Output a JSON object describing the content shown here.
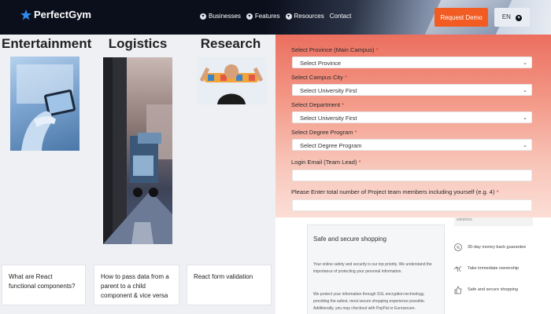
{
  "nav": {
    "brand": "PerfectGym",
    "links": [
      "Businesses",
      "Features",
      "Resources",
      "Contact"
    ],
    "demo_button": "Request Demo",
    "language": "EN"
  },
  "categories": [
    "Entertainment",
    "Logistics",
    "Research"
  ],
  "articles": [
    "What are React functional components?",
    "How to pass data from a parent to a child component & vice versa",
    "React form validation"
  ],
  "form": {
    "province_label": "Select Province (Main Campus)",
    "province_value": "Select Province",
    "city_label": "Select Campus City",
    "city_value": "Select University First",
    "department_label": "Select Department",
    "department_value": "Select University First",
    "degree_label": "Select Degree Program",
    "degree_value": "Select Degree Program",
    "email_label": "Login Email (Team Lead)",
    "email_value": "",
    "members_label": "Please Enter total number of Project team members including yourself (e.g. 4)",
    "members_value": "",
    "required_mark": "*"
  },
  "shop": {
    "strip_text": "solutions",
    "title": "Safe and secure shopping",
    "para1": "Your online safety and security is our top priority. We understand the importance of protecting your personal information.",
    "para2": "We protect your information through SSL encryption technology, providing the safest, most secure shopping experience possible. Additionally, you may checkout with PayPal or Eurosecure.",
    "features": [
      "30-day money back guarantee",
      "Take immediate ownership",
      "Safe and secure shopping"
    ]
  },
  "colors": {
    "accent": "#f25c22",
    "nav_bg": "#0b0f1c"
  }
}
